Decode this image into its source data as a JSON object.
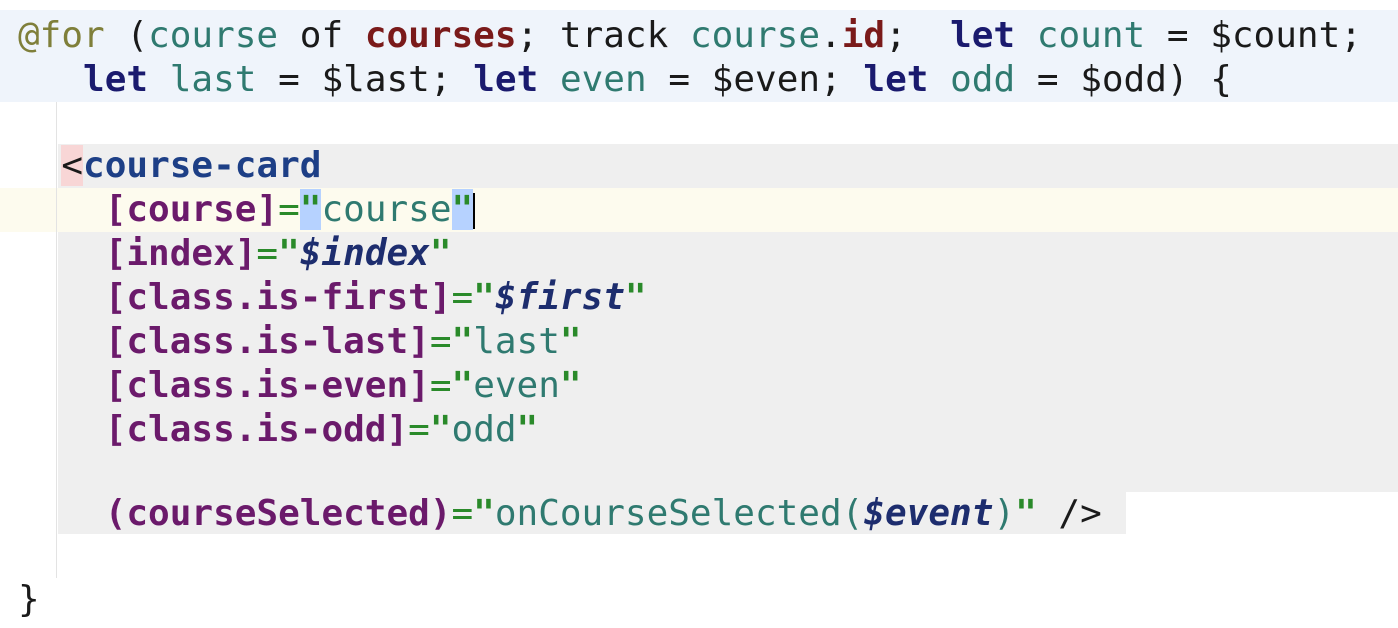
{
  "editor": {
    "lines": [
      {
        "id": "l1",
        "parts": [
          "@for",
          " (",
          "course",
          " of ",
          "courses",
          "; ",
          "track",
          " ",
          "course",
          ".",
          "id",
          ";  ",
          "let",
          " ",
          "count",
          " = ",
          "$count",
          ";"
        ]
      },
      {
        "id": "l2",
        "parts": [
          "   ",
          "let",
          " ",
          "last",
          " = ",
          "$last",
          "; ",
          "let",
          " ",
          "even",
          " = ",
          "$even",
          "; ",
          "let",
          " ",
          "odd",
          " = ",
          "$odd",
          ") {"
        ]
      },
      {
        "id": "l3",
        "parts": []
      },
      {
        "id": "l4",
        "parts": [
          "  ",
          "<",
          "course-card"
        ]
      },
      {
        "id": "l5",
        "parts": [
          "    ",
          "[course]",
          "=",
          "\"",
          "course",
          "\""
        ]
      },
      {
        "id": "l6",
        "parts": [
          "    ",
          "[index]",
          "=",
          "\"",
          "$index",
          "\""
        ]
      },
      {
        "id": "l7",
        "parts": [
          "    ",
          "[class.is-first]",
          "=",
          "\"",
          "$first",
          "\""
        ]
      },
      {
        "id": "l8",
        "parts": [
          "    ",
          "[class.is-last]",
          "=",
          "\"",
          "last",
          "\""
        ]
      },
      {
        "id": "l9",
        "parts": [
          "    ",
          "[class.is-even]",
          "=",
          "\"",
          "even",
          "\""
        ]
      },
      {
        "id": "l10",
        "parts": [
          "    ",
          "[class.is-odd]",
          "=",
          "\"",
          "odd",
          "\""
        ]
      },
      {
        "id": "l11",
        "parts": []
      },
      {
        "id": "l12",
        "parts": [
          "    ",
          "(courseSelected)",
          "=",
          "\"",
          "onCourseSelected(",
          "$event",
          ")",
          "\"",
          " />"
        ]
      },
      {
        "id": "l13",
        "parts": []
      },
      {
        "id": "l14",
        "parts": [
          "}"
        ]
      }
    ]
  }
}
